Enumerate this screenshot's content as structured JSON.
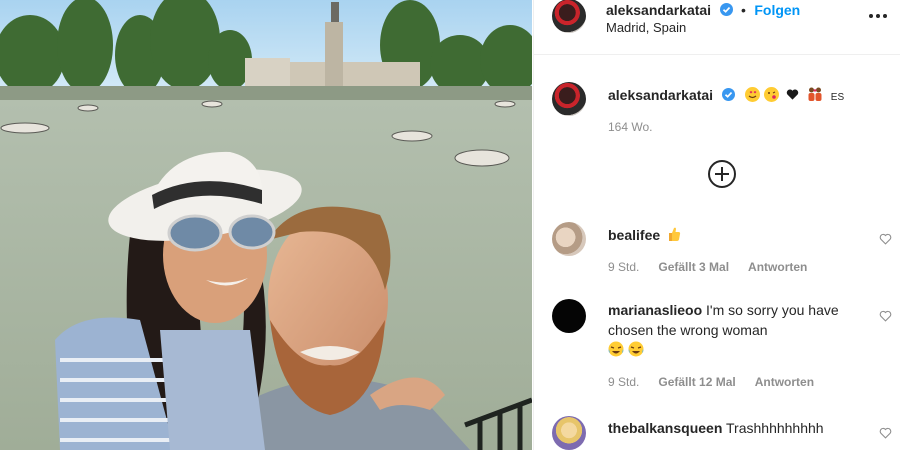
{
  "post": {
    "owner": "aleksandarkatai",
    "follow_label": "Folgen",
    "location": "Madrid, Spain",
    "caption_lang": "ES",
    "caption_time": "164 Wo."
  },
  "comments": [
    {
      "user": "bealifee",
      "text": "",
      "time": "9 Std.",
      "likes": "Gefällt 3 Mal",
      "reply": "Antworten"
    },
    {
      "user": "marianaslieoo",
      "text": "I'm so sorry you have chosen the wrong woman",
      "time": "9 Std.",
      "likes": "Gefällt 12 Mal",
      "reply": "Antworten"
    },
    {
      "user": "thebalkansqueen",
      "text": "Trashhhhhhhhh"
    }
  ],
  "colors": {
    "accent": "#0095f6",
    "verified": "#3897f0",
    "muted": "#8e8e8e"
  },
  "icons": [
    "verified-badge-icon",
    "more-options-icon",
    "add-comment-icon",
    "heart-outline-icon",
    "thumbs-up-emoji",
    "crying-laughing-emoji"
  ]
}
